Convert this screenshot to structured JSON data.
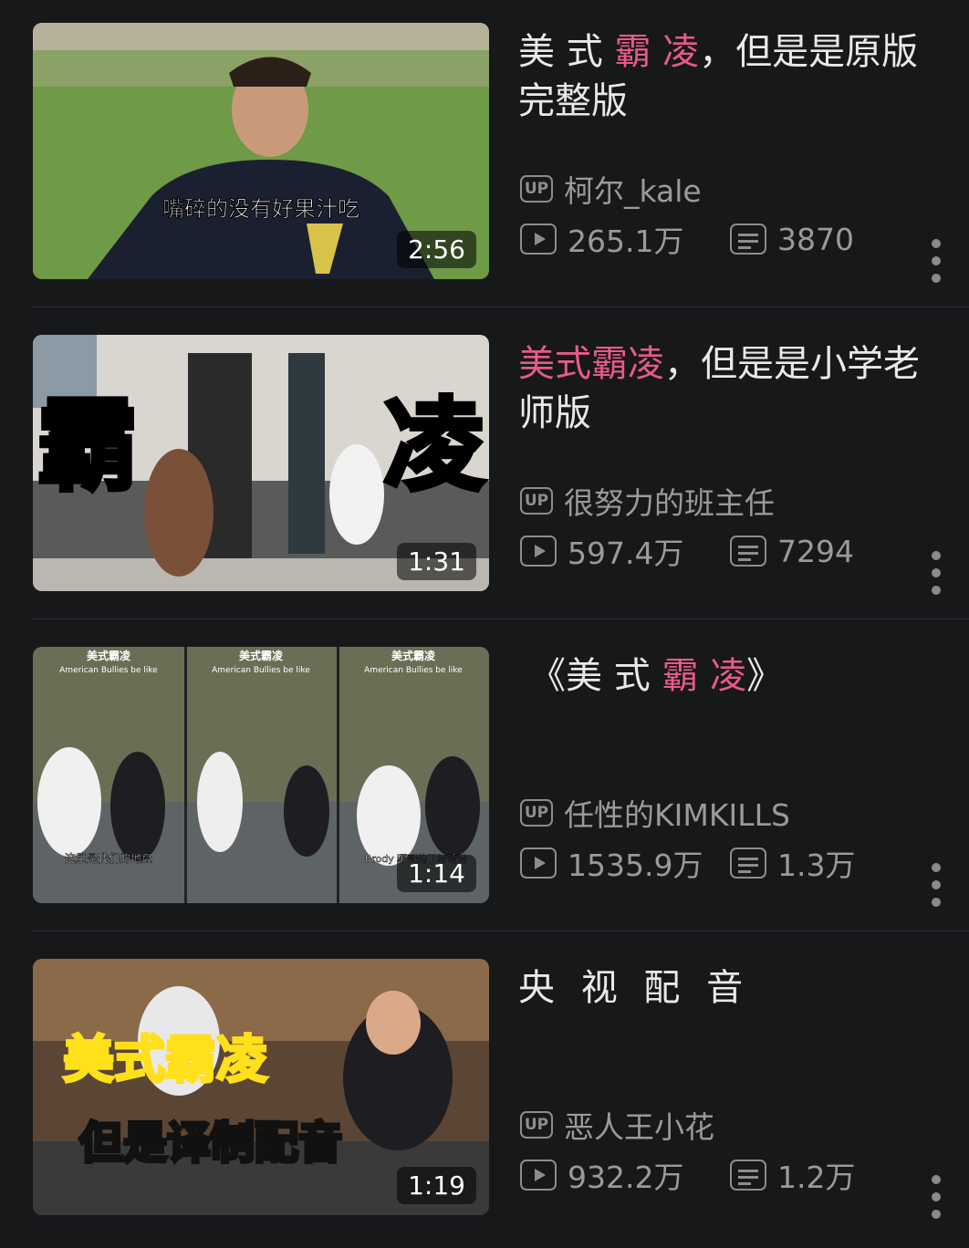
{
  "videos": [
    {
      "title": [
        {
          "t": "美 式 "
        },
        {
          "t": "霸 凌",
          "hl": true
        },
        {
          "t": "，但是是原版完整版"
        }
      ],
      "duration": "2:56",
      "uploader": "柯尔_kale",
      "views": "265.1万",
      "danmaku": "3870",
      "thumb_caption": "嘴碎的没有好果汁吃"
    },
    {
      "title": [
        {
          "t": "美式霸凌",
          "hl": true
        },
        {
          "t": "，但是是小学老师版"
        }
      ],
      "duration": "1:31",
      "uploader": "很努力的班主任",
      "views": "597.4万",
      "danmaku": "7294",
      "thumb_caption_left": "霸",
      "thumb_caption_right": "凌"
    },
    {
      "title": [
        {
          "t": "《美 式 "
        },
        {
          "t": "霸 凌",
          "hl": true
        },
        {
          "t": "》"
        }
      ],
      "duration": "1:14",
      "uploader": "任性的KIMKILLS",
      "views": "1535.9万",
      "danmaku": "1.3万",
      "thumb_panel_title": "美式霸凌",
      "thumb_panel_sub": "American Bullies be like",
      "thumb_caption_a": "这里是我们的地盘",
      "thumb_caption_b": "Brody 吓到他了哈哈哈"
    },
    {
      "title": [
        {
          "t": "央 视 配 音"
        }
      ],
      "duration": "1:19",
      "uploader": "恶人王小花",
      "views": "932.2万",
      "danmaku": "1.2万",
      "thumb_caption_top": "美式霸凌",
      "thumb_caption_bottom": "但是译制配音"
    }
  ],
  "icons": {
    "up": "UP",
    "play": "play-icon",
    "danmaku": "danmaku-icon",
    "more": "more-icon"
  },
  "colors": {
    "background": "#17181a",
    "highlight": "#e55b87",
    "meta": "#9a9a9c"
  }
}
